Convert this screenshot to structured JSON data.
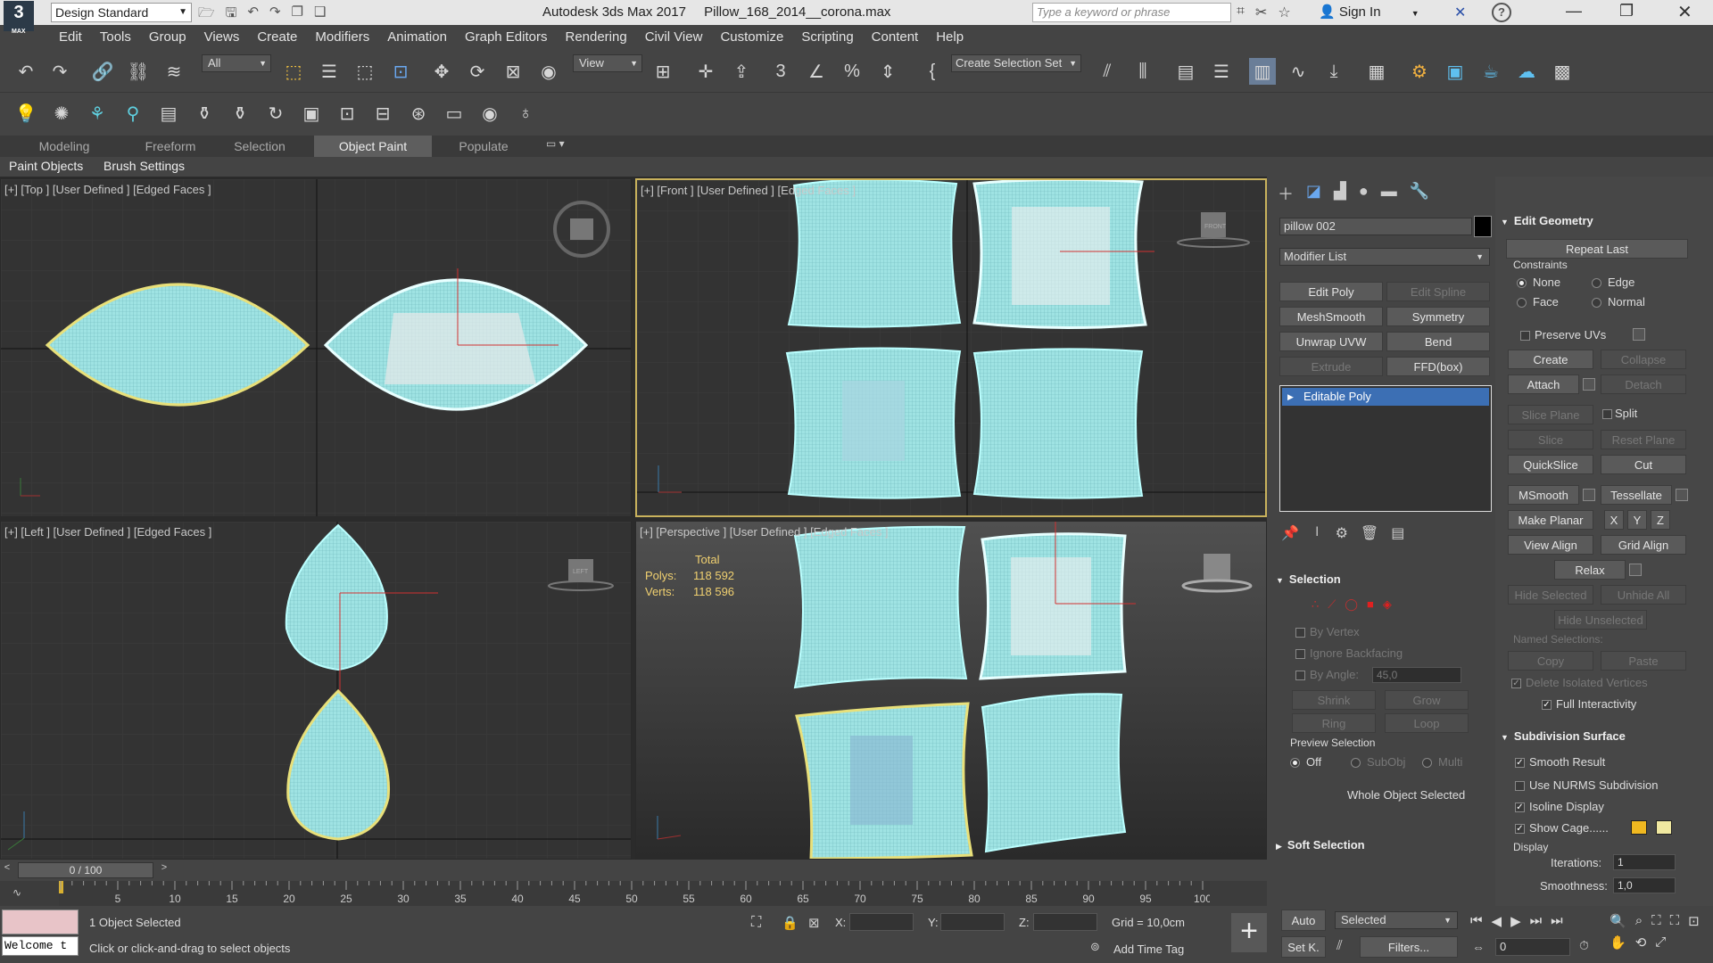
{
  "title_bar": {
    "workspace": "Design Standard",
    "app_title": "Autodesk 3ds Max 2017",
    "file_name": "Pillow_168_2014__corona.max",
    "search_placeholder": "Type a keyword or phrase",
    "sign_in": "Sign In"
  },
  "menu": [
    "Edit",
    "Tools",
    "Group",
    "Views",
    "Create",
    "Modifiers",
    "Animation",
    "Graph Editors",
    "Rendering",
    "Civil View",
    "Customize",
    "Scripting",
    "Content",
    "Help"
  ],
  "main_toolbar": {
    "selection_filter": "All",
    "ref_coord": "View",
    "named_selection": "Create Selection Set"
  },
  "ribbon": {
    "tabs": [
      "Modeling",
      "Freeform",
      "Selection",
      "Object Paint",
      "Populate"
    ],
    "active_tab": "Object Paint",
    "sub_tabs": [
      "Paint Objects",
      "Brush Settings"
    ]
  },
  "viewports": {
    "top": "[+] [Top ] [User Defined ] [Edged Faces ]",
    "front": "[+] [Front ] [User Defined ] [Edged Faces ]",
    "left": "[+] [Left ] [User Defined ] [Edged Faces ]",
    "perspective": "[+] [Perspective ] [User Defined ] [Edged Faces ]",
    "stats": {
      "total": "Total",
      "polys_label": "Polys:",
      "polys": "118 592",
      "verts_label": "Verts:",
      "verts": "118 596"
    },
    "viewcube": {
      "front": "FRONT",
      "left": "LEFT"
    }
  },
  "command_panel": {
    "object_name": "pillow 002",
    "modifier_list": "Modifier List",
    "mod_buttons": [
      "Edit Poly",
      "Edit Spline",
      "MeshSmooth",
      "Symmetry",
      "Unwrap UVW",
      "Bend",
      "Extrude",
      "FFD(box)"
    ],
    "stack_item": "Editable Poly",
    "selection": {
      "title": "Selection",
      "by_vertex": "By Vertex",
      "ignore_backfacing": "Ignore Backfacing",
      "by_angle": "By Angle:",
      "angle_value": "45,0",
      "shrink": "Shrink",
      "grow": "Grow",
      "ring": "Ring",
      "loop": "Loop",
      "preview_title": "Preview Selection",
      "preview_off": "Off",
      "preview_subobj": "SubObj",
      "preview_multi": "Multi",
      "status": "Whole Object Selected"
    },
    "soft_selection": "Soft Selection"
  },
  "edit_geometry": {
    "title": "Edit Geometry",
    "repeat_last": "Repeat Last",
    "constraints": "Constraints",
    "none": "None",
    "edge": "Edge",
    "face": "Face",
    "normal": "Normal",
    "preserve_uvs": "Preserve UVs",
    "create": "Create",
    "collapse": "Collapse",
    "attach": "Attach",
    "detach": "Detach",
    "slice_plane": "Slice Plane",
    "split": "Split",
    "slice": "Slice",
    "reset_plane": "Reset Plane",
    "quickslice": "QuickSlice",
    "cut": "Cut",
    "msmooth": "MSmooth",
    "tessellate": "Tessellate",
    "make_planar": "Make Planar",
    "x": "X",
    "y": "Y",
    "z": "Z",
    "view_align": "View Align",
    "grid_align": "Grid Align",
    "relax": "Relax",
    "hide_selected": "Hide Selected",
    "unhide_all": "Unhide All",
    "hide_unselected": "Hide Unselected",
    "named_selections": "Named Selections:",
    "copy": "Copy",
    "paste": "Paste",
    "delete_isolated": "Delete Isolated Vertices",
    "full_interactivity": "Full Interactivity"
  },
  "subdivision": {
    "title": "Subdivision Surface",
    "smooth_result": "Smooth Result",
    "use_nurms": "Use NURMS Subdivision",
    "isoline": "Isoline Display",
    "show_cage": "Show Cage......",
    "display": "Display",
    "iterations_label": "Iterations:",
    "iterations": "1",
    "smoothness_label": "Smoothness:",
    "smoothness": "1,0"
  },
  "timeline": {
    "frame": "0 / 100",
    "ticks": [
      "5",
      "10",
      "15",
      "20",
      "25",
      "30",
      "35",
      "40",
      "45",
      "50",
      "55",
      "60",
      "65",
      "70",
      "75",
      "80",
      "85",
      "90",
      "95",
      "100"
    ]
  },
  "status_bar": {
    "maxscript": "Welcome t",
    "selected": "1 Object Selected",
    "prompt": "Click or click-and-drag to select objects",
    "x_label": "X:",
    "y_label": "Y:",
    "z_label": "Z:",
    "grid": "Grid = 10,0cm",
    "add_time_tag": "Add Time Tag",
    "auto": "Auto",
    "set_key": "Set K.",
    "key_filter": "Selected",
    "filters": "Filters...",
    "frame_value": "0"
  },
  "colors": {
    "mesh": "#9fe3e3",
    "selection": "#e8e07a",
    "accent": "#4a7fc8"
  }
}
